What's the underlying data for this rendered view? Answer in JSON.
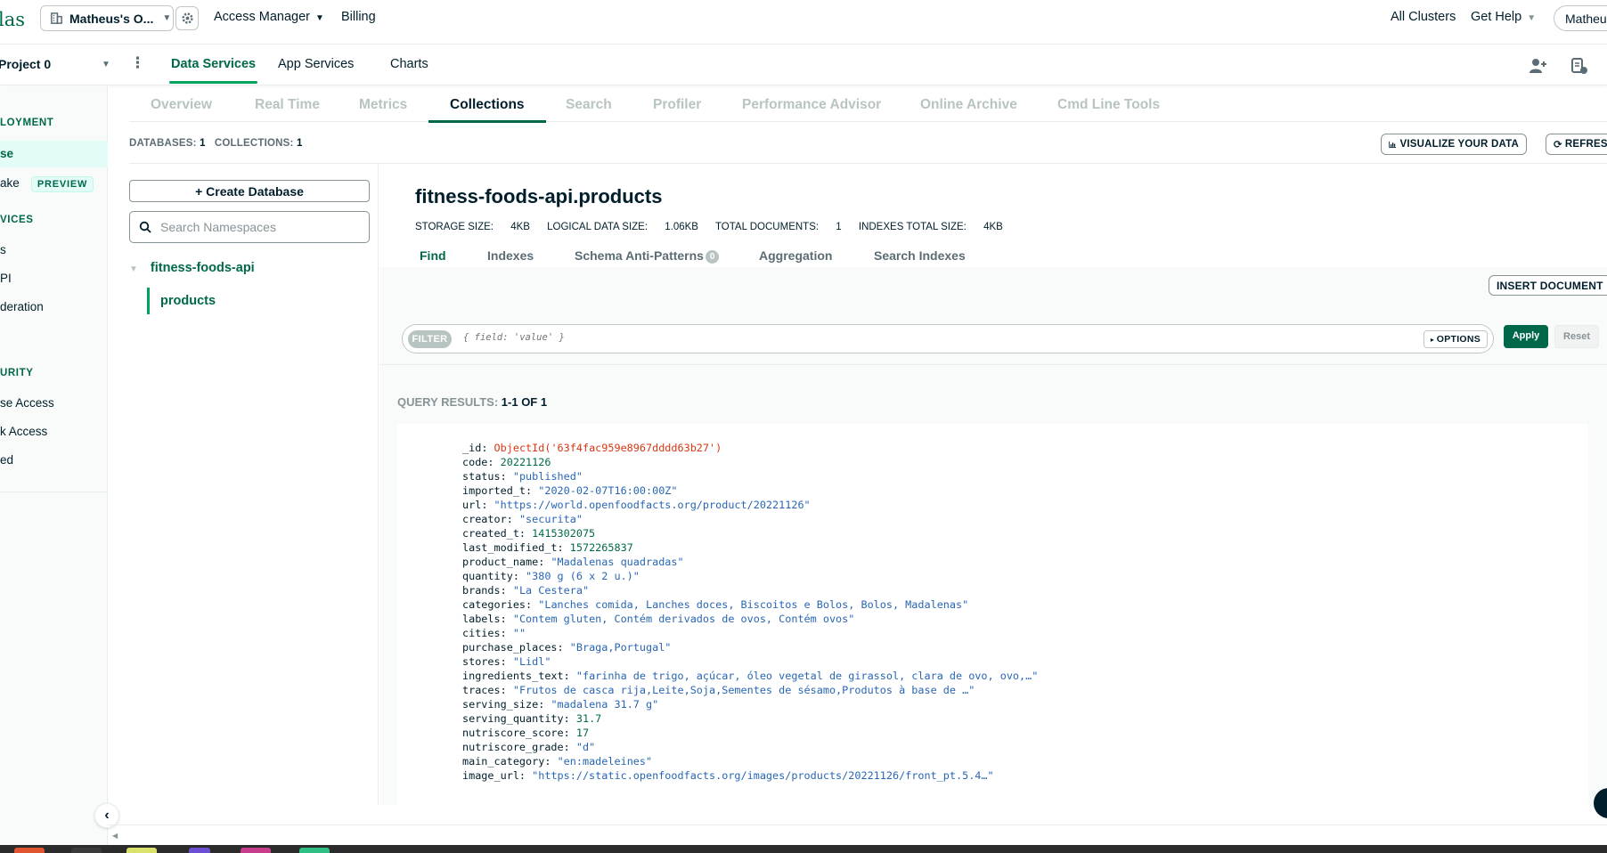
{
  "topbar": {
    "logo": "las",
    "org": "Matheus's O...",
    "access_manager": "Access Manager",
    "billing": "Billing",
    "all_clusters": "All Clusters",
    "get_help": "Get Help",
    "user": "Matheus"
  },
  "projectbar": {
    "project": "Project 0",
    "tabs": [
      "Data Services",
      "App Services",
      "Charts"
    ]
  },
  "sidebar": {
    "sections": [
      "LOYMENT",
      "VICES",
      "URITY"
    ],
    "items": [
      "se",
      "ake",
      "s",
      "PI",
      "deration",
      "se Access",
      "k Access",
      "ed"
    ],
    "preview_badge": "PREVIEW"
  },
  "subtabs": [
    "Overview",
    "Real Time",
    "Metrics",
    "Collections",
    "Search",
    "Profiler",
    "Performance Advisor",
    "Online Archive",
    "Cmd Line Tools"
  ],
  "counts": {
    "databases_label": "DATABASES:",
    "databases": "1",
    "collections_label": "COLLECTIONS:",
    "collections": "1"
  },
  "actions": {
    "visualize": "VISUALIZE YOUR DATA",
    "refresh": "REFRESH"
  },
  "namespace": {
    "create_db": "Create Database",
    "search_placeholder": "Search Namespaces",
    "database": "fitness-foods-api",
    "collection": "products"
  },
  "collection": {
    "title": "fitness-foods-api.products",
    "stats": [
      {
        "label": "STORAGE SIZE:",
        "value": "4KB"
      },
      {
        "label": "LOGICAL DATA SIZE:",
        "value": "1.06KB"
      },
      {
        "label": "TOTAL DOCUMENTS:",
        "value": "1"
      },
      {
        "label": "INDEXES TOTAL SIZE:",
        "value": "4KB"
      }
    ],
    "tabs": [
      "Find",
      "Indexes",
      "Schema Anti-Patterns",
      "Aggregation",
      "Search Indexes"
    ],
    "anti_patterns_count": "0"
  },
  "find": {
    "insert": "INSERT DOCUMENT",
    "filter_chip": "FILTER",
    "filter_placeholder": "{ field: 'value' }",
    "options": "OPTIONS",
    "apply": "Apply",
    "reset": "Reset",
    "results_label": "QUERY RESULTS:",
    "results_value": "1-1 OF 1"
  },
  "document": [
    {
      "key": "_id",
      "value": "ObjectId('63f4fac959e8967dddd63b27')",
      "type": "oid"
    },
    {
      "key": "code",
      "value": "20221126",
      "type": "num"
    },
    {
      "key": "status",
      "value": "\"published\"",
      "type": "str"
    },
    {
      "key": "imported_t",
      "value": "\"2020-02-07T16:00:00Z\"",
      "type": "str"
    },
    {
      "key": "url",
      "value": "\"https://world.openfoodfacts.org/product/20221126\"",
      "type": "str"
    },
    {
      "key": "creator",
      "value": "\"securita\"",
      "type": "str"
    },
    {
      "key": "created_t",
      "value": "1415302075",
      "type": "num"
    },
    {
      "key": "last_modified_t",
      "value": "1572265837",
      "type": "num"
    },
    {
      "key": "product_name",
      "value": "\"Madalenas quadradas\"",
      "type": "str"
    },
    {
      "key": "quantity",
      "value": "\"380 g (6 x 2 u.)\"",
      "type": "str"
    },
    {
      "key": "brands",
      "value": "\"La Cestera\"",
      "type": "str"
    },
    {
      "key": "categories",
      "value": "\"Lanches comida, Lanches doces, Biscoitos e Bolos, Bolos, Madalenas\"",
      "type": "str"
    },
    {
      "key": "labels",
      "value": "\"Contem gluten, Contém derivados de ovos, Contém ovos\"",
      "type": "str"
    },
    {
      "key": "cities",
      "value": "\"\"",
      "type": "str"
    },
    {
      "key": "purchase_places",
      "value": "\"Braga,Portugal\"",
      "type": "str"
    },
    {
      "key": "stores",
      "value": "\"Lidl\"",
      "type": "str"
    },
    {
      "key": "ingredients_text",
      "value": "\"farinha de trigo, açúcar, óleo vegetal de girassol, clara de ovo, ovo,…\"",
      "type": "str"
    },
    {
      "key": "traces",
      "value": "\"Frutos de casca rija,Leite,Soja,Sementes de sésamo,Produtos à base de …\"",
      "type": "str"
    },
    {
      "key": "serving_size",
      "value": "\"madalena 31.7 g\"",
      "type": "str"
    },
    {
      "key": "serving_quantity",
      "value": "31.7",
      "type": "num"
    },
    {
      "key": "nutriscore_score",
      "value": "17",
      "type": "num"
    },
    {
      "key": "nutriscore_grade",
      "value": "\"d\"",
      "type": "str"
    },
    {
      "key": "main_category",
      "value": "\"en:madeleines\"",
      "type": "str"
    },
    {
      "key": "image_url",
      "value": "\"https://static.openfoodfacts.org/images/products/20221126/front_pt.5.4…\"",
      "type": "str"
    }
  ],
  "colors": {
    "brand_green": "#00684a",
    "accent_green": "#00a35c",
    "oid_red": "#d83713",
    "string_blue": "#2866b4"
  }
}
